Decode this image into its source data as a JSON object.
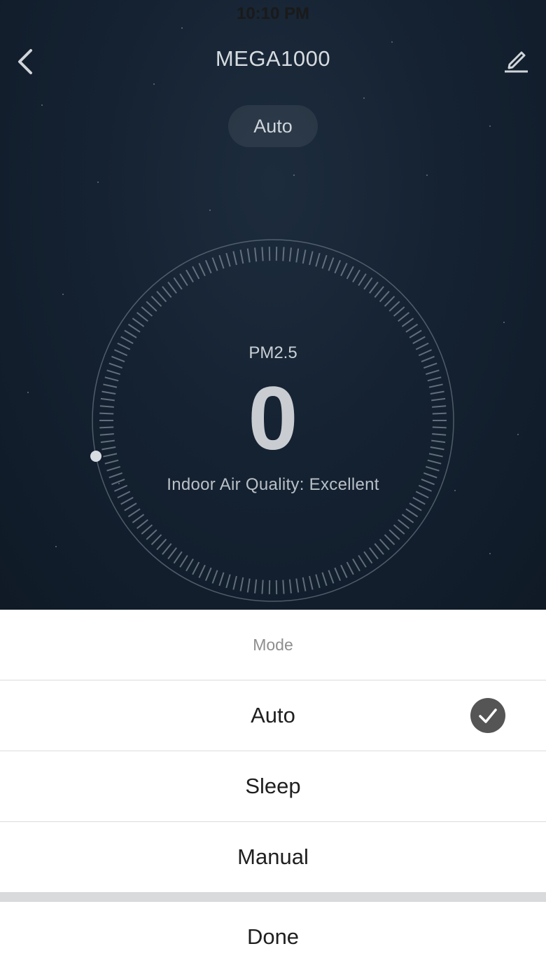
{
  "status_bar": {
    "carrier": "",
    "time": "10:10 PM",
    "battery": ""
  },
  "header": {
    "title": "MEGA1000",
    "back_icon": "chevron-left-icon",
    "edit_icon": "pencil-icon"
  },
  "current_mode": "Auto",
  "reading": {
    "label": "PM2.5",
    "value": "0",
    "quality_text": "Indoor Air Quality: Excellent"
  },
  "sheet": {
    "title": "Mode",
    "options": [
      {
        "label": "Auto",
        "selected": true
      },
      {
        "label": "Sleep",
        "selected": false
      },
      {
        "label": "Manual",
        "selected": false
      }
    ],
    "done_label": "Done"
  },
  "colors": {
    "background_dark": "#152232",
    "check_fill": "#555555",
    "separator": "#d9dadc"
  }
}
